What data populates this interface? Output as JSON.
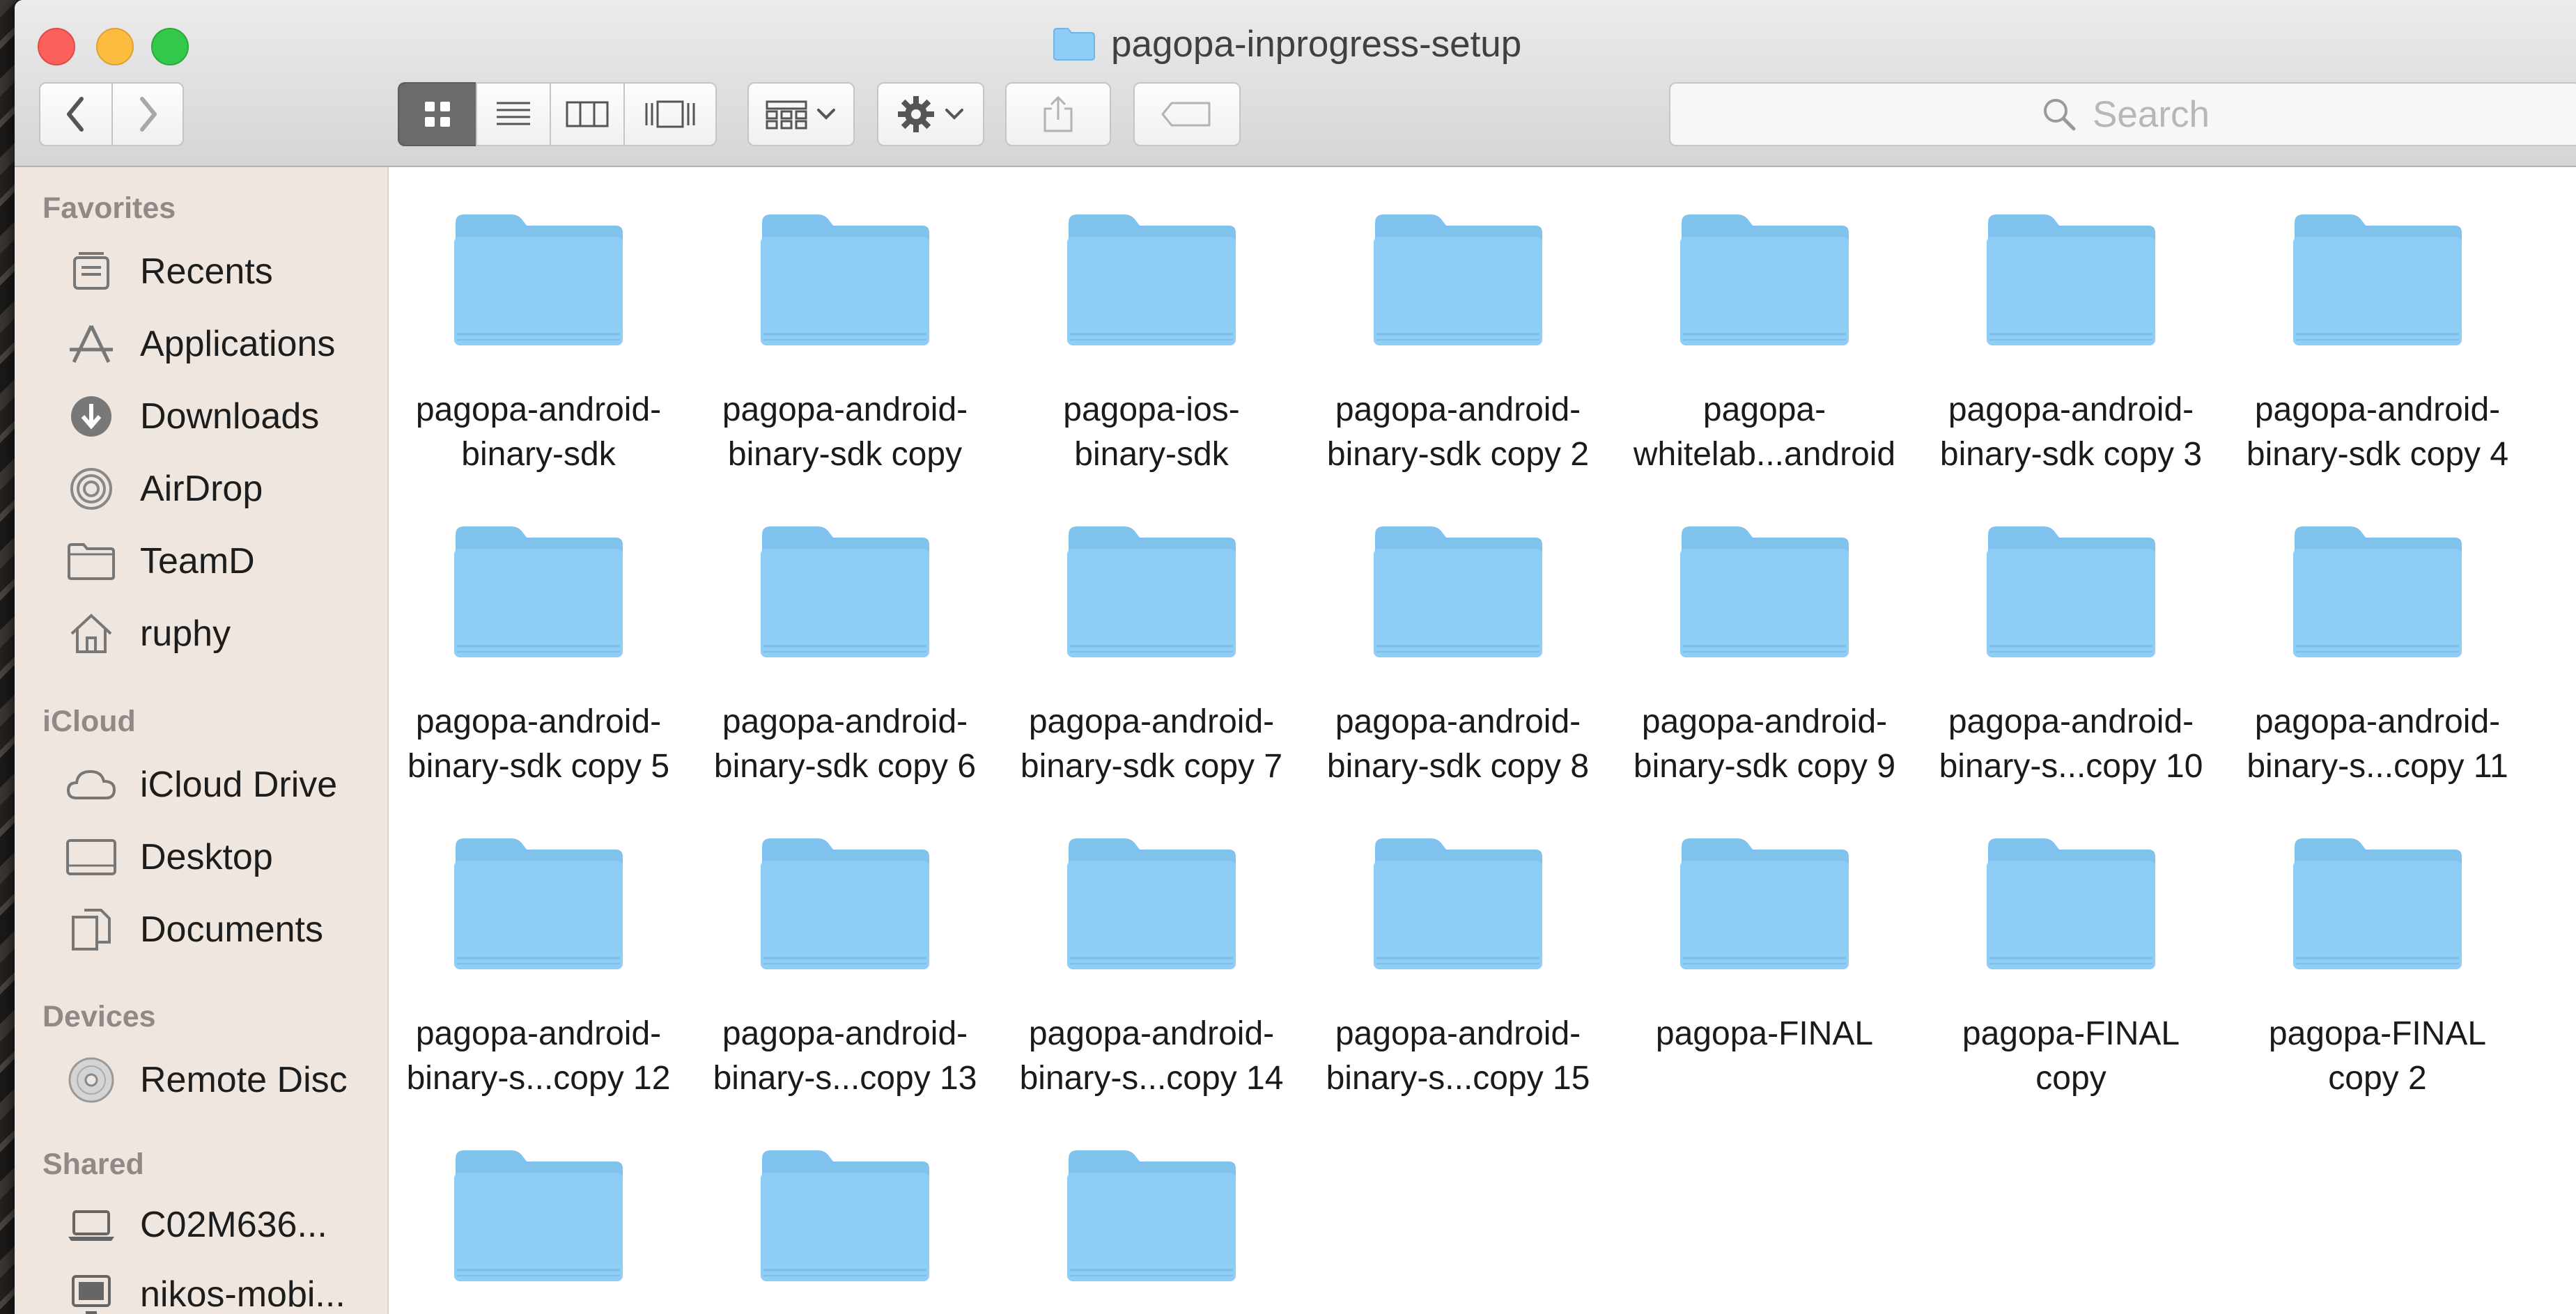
{
  "window": {
    "title": "pagopa-inprogress-setup"
  },
  "toolbar": {
    "back_icon": "chevron-left-icon",
    "forward_icon": "chevron-right-icon",
    "view_modes": [
      "icon-view",
      "list-view",
      "column-view",
      "cover-flow-view"
    ],
    "selected_view": "icon-view",
    "search_placeholder": "Search"
  },
  "sidebar": {
    "sections": [
      {
        "title": "Favorites",
        "items": [
          {
            "label": "Recents",
            "icon": "recents-icon"
          },
          {
            "label": "Applications",
            "icon": "applications-icon"
          },
          {
            "label": "Downloads",
            "icon": "downloads-icon"
          },
          {
            "label": "AirDrop",
            "icon": "airdrop-icon"
          },
          {
            "label": "TeamD",
            "icon": "folder-icon"
          },
          {
            "label": "ruphy",
            "icon": "home-icon"
          }
        ]
      },
      {
        "title": "iCloud",
        "items": [
          {
            "label": "iCloud Drive",
            "icon": "cloud-icon"
          },
          {
            "label": "Desktop",
            "icon": "desktop-icon"
          },
          {
            "label": "Documents",
            "icon": "documents-icon"
          }
        ]
      },
      {
        "title": "Devices",
        "items": [
          {
            "label": "Remote Disc",
            "icon": "disc-icon"
          }
        ]
      },
      {
        "title": "Shared",
        "items": [
          {
            "label": "C02M636...",
            "icon": "laptop-icon"
          },
          {
            "label": "nikos-mobi...",
            "icon": "display-icon"
          }
        ]
      }
    ]
  },
  "folders": [
    {
      "line1": "pagopa-android-",
      "line2": "binary-sdk"
    },
    {
      "line1": "pagopa-android-",
      "line2": "binary-sdk copy"
    },
    {
      "line1": "pagopa-ios-",
      "line2": "binary-sdk"
    },
    {
      "line1": "pagopa-android-",
      "line2": "binary-sdk copy 2"
    },
    {
      "line1": "pagopa-",
      "line2": "whitelab...android"
    },
    {
      "line1": "pagopa-android-",
      "line2": "binary-sdk copy 3"
    },
    {
      "line1": "pagopa-android-",
      "line2": "binary-sdk copy 4"
    },
    {
      "line1": "pagopa-android-",
      "line2": "binary-sdk copy 5"
    },
    {
      "line1": "pagopa-android-",
      "line2": "binary-sdk copy 6"
    },
    {
      "line1": "pagopa-android-",
      "line2": "binary-sdk copy 7"
    },
    {
      "line1": "pagopa-android-",
      "line2": "binary-sdk copy 8"
    },
    {
      "line1": "pagopa-android-",
      "line2": "binary-sdk copy 9"
    },
    {
      "line1": "pagopa-android-",
      "line2": "binary-s...copy 10"
    },
    {
      "line1": "pagopa-android-",
      "line2": "binary-s...copy 11"
    },
    {
      "line1": "pagopa-android-",
      "line2": "binary-s...copy 12"
    },
    {
      "line1": "pagopa-android-",
      "line2": "binary-s...copy 13"
    },
    {
      "line1": "pagopa-android-",
      "line2": "binary-s...copy 14"
    },
    {
      "line1": "pagopa-android-",
      "line2": "binary-s...copy 15"
    },
    {
      "line1": "pagopa-FINAL",
      "line2": ""
    },
    {
      "line1": "pagopa-FINAL",
      "line2": "copy"
    },
    {
      "line1": "pagopa-FINAL",
      "line2": "copy 2"
    },
    {
      "line1": "",
      "line2": ""
    },
    {
      "line1": "",
      "line2": ""
    },
    {
      "line1": "",
      "line2": ""
    }
  ],
  "colors": {
    "folder": "#8ecdf5",
    "folder_tab": "#7fc2ee",
    "sidebar_bg": "#efe7df",
    "selected_view_bg": "#6b6b6b"
  }
}
